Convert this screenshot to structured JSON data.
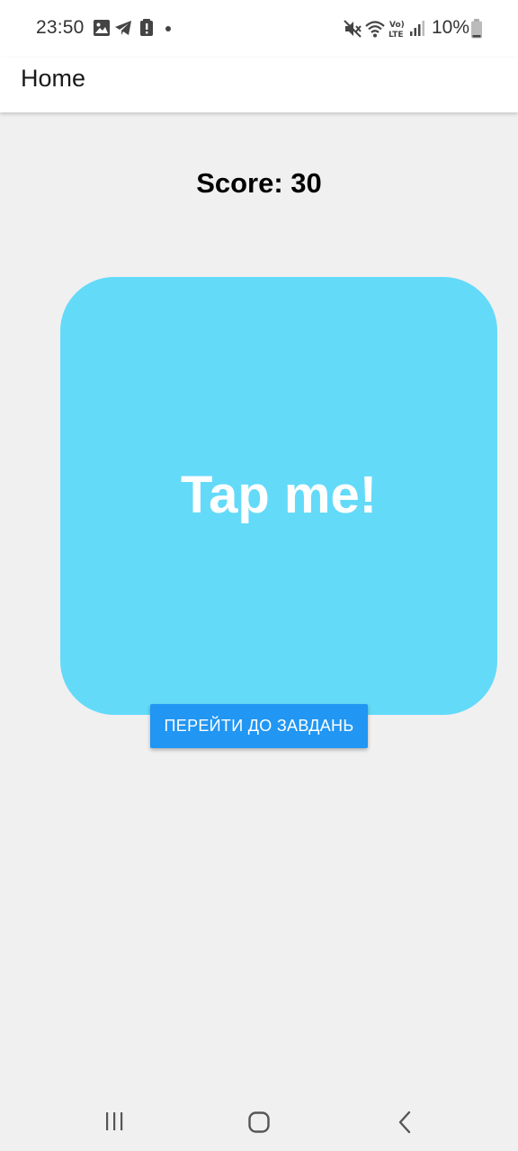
{
  "status_bar": {
    "time": "23:50",
    "battery": "10%",
    "left_icons": [
      "image-icon",
      "telegram-icon",
      "alert-icon",
      "dot-icon"
    ],
    "right_icons": [
      "mute-icon",
      "wifi-icon",
      "volte-icon",
      "signal-icon",
      "battery-icon"
    ]
  },
  "app_bar": {
    "title": "Home"
  },
  "game": {
    "score_text": "Score: 30",
    "tap_label": "Tap me!",
    "tap_color": "#64daf9",
    "button_label": "ПЕРЕЙТИ ДО ЗАВДАНЬ",
    "button_color": "#2196f3"
  },
  "system_nav": {
    "icons": [
      "recents-icon",
      "home-icon",
      "back-icon"
    ]
  }
}
